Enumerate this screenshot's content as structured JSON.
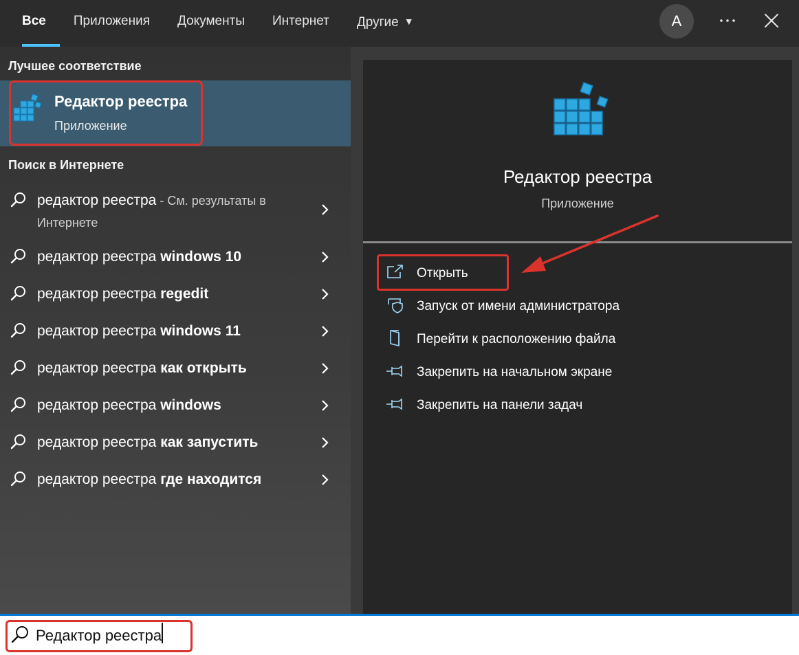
{
  "tabs": [
    {
      "label": "Все"
    },
    {
      "label": "Приложения"
    },
    {
      "label": "Документы"
    },
    {
      "label": "Интернет"
    },
    {
      "label": "Другие"
    }
  ],
  "account": {
    "initial": "A"
  },
  "best_match": {
    "section_title": "Лучшее соответствие",
    "title": "Редактор реестра",
    "subtitle": "Приложение"
  },
  "web": {
    "section_title": "Поиск в Интернете",
    "items": [
      {
        "prefix": "редактор реестра",
        "bold": "",
        "suffix": " - См. результаты в Интернете"
      },
      {
        "prefix": "редактор реестра ",
        "bold": "windows 10",
        "suffix": ""
      },
      {
        "prefix": "редактор реестра ",
        "bold": "regedit",
        "suffix": ""
      },
      {
        "prefix": "редактор реестра ",
        "bold": "windows 11",
        "suffix": ""
      },
      {
        "prefix": "редактор реестра ",
        "bold": "как открыть",
        "suffix": ""
      },
      {
        "prefix": "редактор реестра ",
        "bold": "windows",
        "suffix": ""
      },
      {
        "prefix": "редактор реестра ",
        "bold": "как запустить",
        "suffix": ""
      },
      {
        "prefix": "редактор реестра ",
        "bold": "где находится",
        "suffix": ""
      }
    ]
  },
  "preview": {
    "title": "Редактор реестра",
    "subtitle": "Приложение",
    "actions": [
      {
        "label": "Открыть",
        "icon": "open-icon"
      },
      {
        "label": "Запуск от имени администратора",
        "icon": "shield-icon"
      },
      {
        "label": "Перейти к расположению файла",
        "icon": "folder-icon"
      },
      {
        "label": "Закрепить на начальном экране",
        "icon": "pin-icon"
      },
      {
        "label": "Закрепить на панели задач",
        "icon": "pin-icon"
      }
    ]
  },
  "search": {
    "value": "Редактор реестра"
  },
  "colors": {
    "accent": "#4cc2ff",
    "selection": "#3a5b70",
    "highlight": "#d9332b",
    "registry_blue": "#2ea8e0"
  }
}
